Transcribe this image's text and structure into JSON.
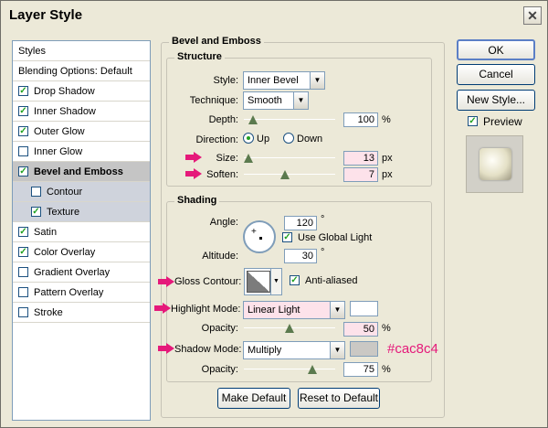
{
  "window": {
    "title": "Layer Style",
    "close_icon": "close-icon"
  },
  "styles_panel": {
    "items": [
      {
        "label": "Styles",
        "checked": null,
        "header": true
      },
      {
        "label": "Blending Options: Default",
        "checked": null,
        "header": true
      },
      {
        "label": "Drop Shadow",
        "checked": true
      },
      {
        "label": "Inner Shadow",
        "checked": true
      },
      {
        "label": "Outer Glow",
        "checked": true
      },
      {
        "label": "Inner Glow",
        "checked": false
      },
      {
        "label": "Bevel and Emboss",
        "checked": true,
        "selected": true
      },
      {
        "label": "Contour",
        "checked": false,
        "sub": true
      },
      {
        "label": "Texture",
        "checked": true,
        "sub": true
      },
      {
        "label": "Satin",
        "checked": true
      },
      {
        "label": "Color Overlay",
        "checked": true
      },
      {
        "label": "Gradient Overlay",
        "checked": false
      },
      {
        "label": "Pattern Overlay",
        "checked": false
      },
      {
        "label": "Stroke",
        "checked": false
      }
    ]
  },
  "bevel": {
    "group_title": "Bevel and Emboss",
    "structure": {
      "title": "Structure",
      "style_label": "Style:",
      "style_value": "Inner Bevel",
      "technique_label": "Technique:",
      "technique_value": "Smooth",
      "depth_label": "Depth:",
      "depth_value": "100",
      "depth_unit": "%",
      "depth_slider": 0.1,
      "direction_label": "Direction:",
      "dir_up": "Up",
      "dir_down": "Down",
      "direction_selected": "Up",
      "size_label": "Size:",
      "size_value": "13",
      "size_unit": "px",
      "size_slider": 0.05,
      "soften_label": "Soften:",
      "soften_value": "7",
      "soften_unit": "px",
      "soften_slider": 0.45
    },
    "shading": {
      "title": "Shading",
      "angle_label": "Angle:",
      "angle_value": "120",
      "angle_unit": "°",
      "global_light_label": "Use Global Light",
      "global_light_checked": true,
      "altitude_label": "Altitude:",
      "altitude_value": "30",
      "altitude_unit": "°",
      "gloss_label": "Gloss Contour:",
      "anti_aliased_label": "Anti-aliased",
      "anti_aliased_checked": true,
      "highlight_label": "Highlight Mode:",
      "highlight_value": "Linear Light",
      "highlight_color": "#ffffff",
      "hl_opacity_label": "Opacity:",
      "hl_opacity_value": "50",
      "hl_opacity_unit": "%",
      "hl_opacity_slider": 0.5,
      "shadow_label": "Shadow Mode:",
      "shadow_value": "Multiply",
      "shadow_color": "#cac8c4",
      "sh_opacity_label": "Opacity:",
      "sh_opacity_value": "75",
      "sh_opacity_unit": "%",
      "sh_opacity_slider": 0.75
    },
    "make_default": "Make Default",
    "reset_default": "Reset to Default"
  },
  "right": {
    "ok": "OK",
    "cancel": "Cancel",
    "new_style": "New Style...",
    "preview_label": "Preview",
    "preview_checked": true
  },
  "annotation": "#cac8c4",
  "colors": {
    "accent": "#e5197a",
    "pink_field": "#fde2ea"
  }
}
